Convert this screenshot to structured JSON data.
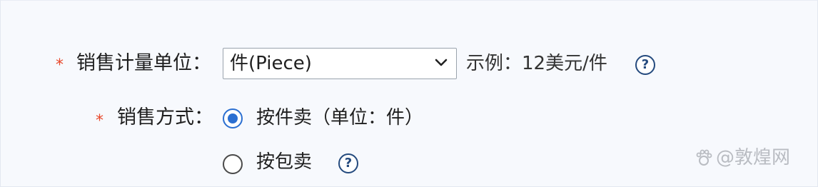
{
  "form": {
    "unit_field": {
      "required_mark": "*",
      "label": "销售计量单位：",
      "selected_value": "件(Piece)",
      "example_text": "示例：12美元/件",
      "help_glyph": "?",
      "dropdown_icon": "chevron-down-icon",
      "help_icon": "question-circle-icon"
    },
    "sale_mode_field": {
      "required_mark": "*",
      "label": "销售方式：",
      "options": [
        {
          "label": "按件卖（单位：件）",
          "selected": true
        },
        {
          "label": "按包卖",
          "selected": false
        }
      ],
      "help_glyph": "?",
      "help_icon": "question-circle-icon"
    }
  },
  "watermark": {
    "text": "@敦煌网",
    "logo_icon": "paw-logo-icon"
  },
  "colors": {
    "required": "#e8472a",
    "radio_selected": "#2b6fd1",
    "help_icon": "#244a7e",
    "panel_background": "#f7f9fd"
  }
}
